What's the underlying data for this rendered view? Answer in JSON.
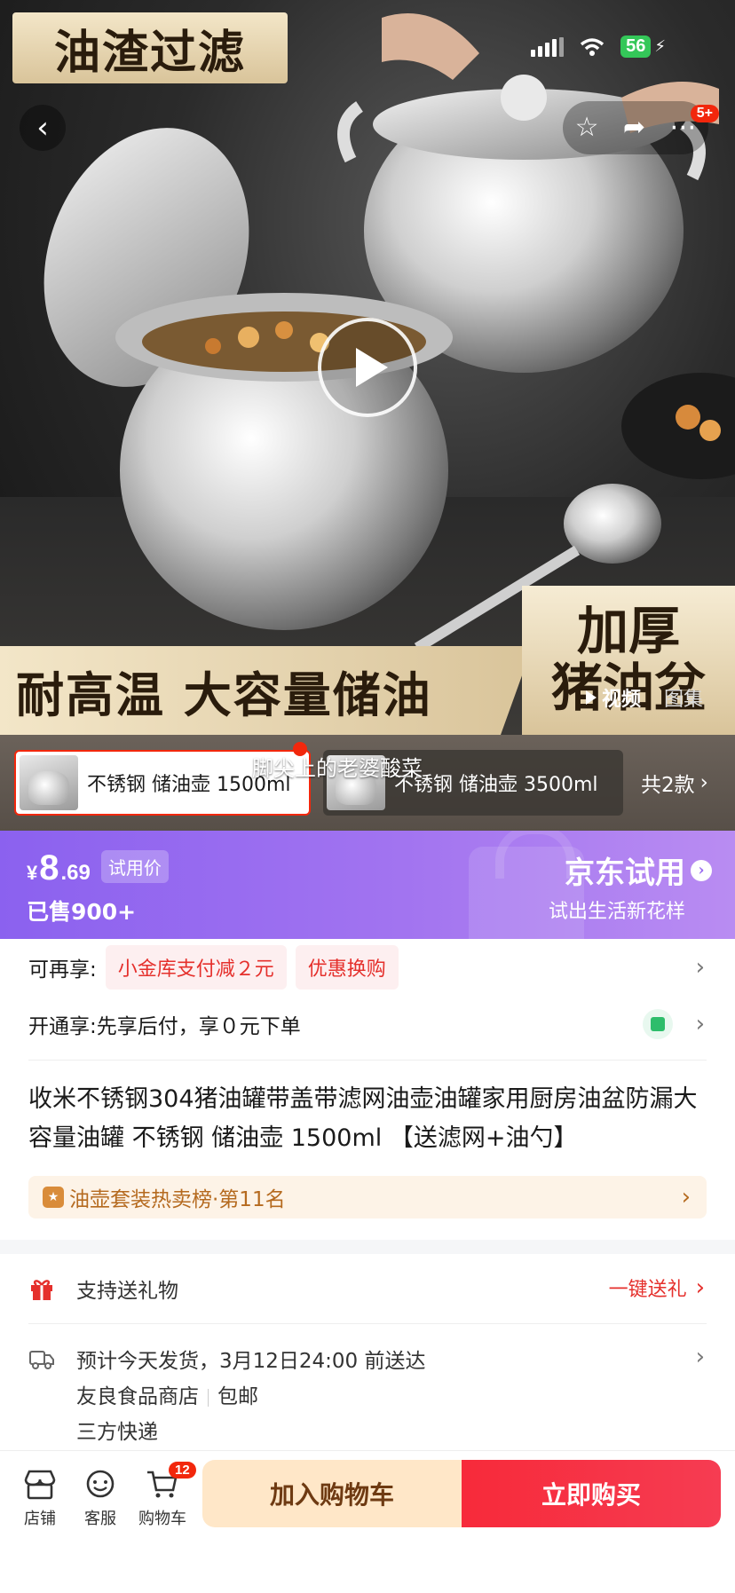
{
  "status_bar": {
    "battery": "56"
  },
  "hero": {
    "banner_top": "油渣过滤",
    "promo_bottom": "耐高温 大容量储油",
    "promo_right_line1": "加厚",
    "promo_right_line2": "猪油盆",
    "media_video": "视频",
    "media_gallery": "图集",
    "overlay_comment": "脚尖上的老婆酸菜",
    "message_badge": "5+"
  },
  "variants": {
    "items": [
      {
        "label": "不锈钢 储油壶 1500ml",
        "selected": true
      },
      {
        "label": "不锈钢 储油壶 3500ml",
        "selected": false
      }
    ],
    "total": "共2款"
  },
  "price": {
    "currency": "¥",
    "integer": "8",
    "decimal": ".69",
    "tag": "试用价",
    "sold": "已售900+",
    "jd_trial_title": "京东试用",
    "jd_trial_sub": "试出生活新花样"
  },
  "offers": {
    "row1_title": "可再享:",
    "chip1": "小金库支付减２元",
    "chip2": "优惠换购",
    "row2_text": "开通享:先享后付，享０元下单"
  },
  "product": {
    "title": "收米不锈钢304猪油罐带盖带滤网油壶油罐家用厨房油盆防漏大容量油罐 不锈钢 储油壶 1500ml 【送滤网+油勺】",
    "rank": "油壶套装热卖榜·第11名"
  },
  "service": {
    "gift_label": "支持送礼物",
    "gift_action": "一键送礼",
    "delivery_line": "预计今天发货，3月12日24:00 前送达",
    "shop": "友良食品商店",
    "shipping": "包邮",
    "courier": "三方快递"
  },
  "bottom_nav": {
    "shop": "店铺",
    "service": "客服",
    "cart": "购物车",
    "cart_count": "12",
    "add_to_cart": "加入购物车",
    "buy_now": "立即购买"
  },
  "colors": {
    "accent_red": "#f2270c",
    "trial_purple": "#8b61ef",
    "cart_bg": "#ffe7c8"
  }
}
